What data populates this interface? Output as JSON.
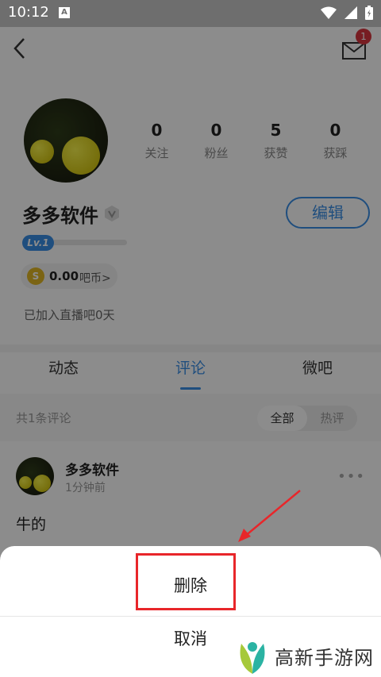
{
  "status_bar": {
    "time": "10:12",
    "notif_letter": "A"
  },
  "header": {
    "mail_badge": "1"
  },
  "profile": {
    "username": "多多软件",
    "edit_label": "编辑",
    "level": "Lv.1",
    "level_progress": 0.0,
    "coin_value": "0.00",
    "coin_unit": "吧币>",
    "coin_symbol": "S",
    "joined": "已加入直播吧0天",
    "stats": [
      {
        "value": "0",
        "label": "关注"
      },
      {
        "value": "0",
        "label": "粉丝"
      },
      {
        "value": "5",
        "label": "获赞"
      },
      {
        "value": "0",
        "label": "获踩"
      }
    ]
  },
  "tabs": [
    {
      "label": "动态",
      "active": false
    },
    {
      "label": "评论",
      "active": true
    },
    {
      "label": "微吧",
      "active": false
    }
  ],
  "comments": {
    "count_text": "共1条评论",
    "filters": [
      {
        "label": "全部",
        "active": true
      },
      {
        "label": "热评",
        "active": false
      }
    ],
    "item": {
      "author": "多多软件",
      "time": "1分钟前",
      "text": "牛的",
      "more": "•••"
    }
  },
  "action_sheet": {
    "delete_label": "删除",
    "cancel_label": "取消"
  },
  "watermark": {
    "text": "高新手游网"
  },
  "colors": {
    "accent": "#3a8ee6",
    "badge": "#d9363e",
    "annotation": "#e8262a"
  }
}
